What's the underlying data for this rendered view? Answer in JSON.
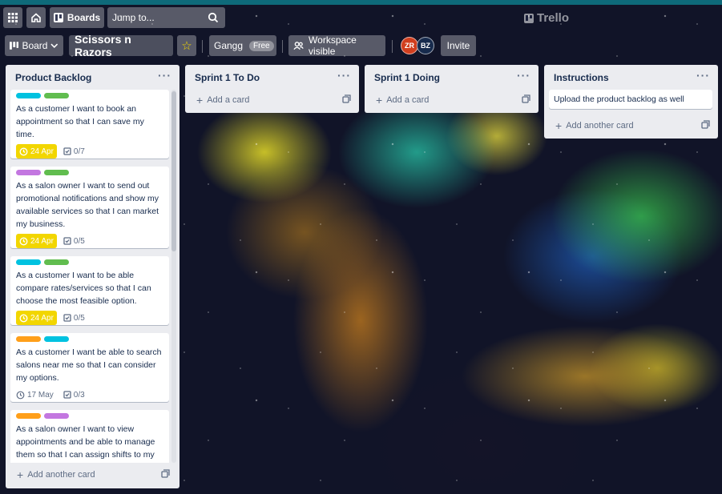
{
  "topbar": {
    "boards_label": "Boards",
    "search_label": "Jump to...",
    "logo_text": "Trello"
  },
  "board_header": {
    "view_label": "Board",
    "title": "Scissors n Razors",
    "workspace_name": "Gangg",
    "workspace_plan": "Free",
    "visibility_label": "Workspace visible",
    "members": [
      "ZR",
      "BZ"
    ],
    "invite_label": "Invite"
  },
  "colors": {
    "label_cyan": "#00c2e0",
    "label_green": "#61bd4f",
    "label_purple": "#c377e0",
    "label_orange": "#ff9f1a",
    "due_soon": "#f2d600"
  },
  "lists": [
    {
      "title": "Product Backlog",
      "add_label": "Add another card",
      "cards": [
        {
          "labels": [
            "cyan",
            "green"
          ],
          "text": "As a customer I want to book an appointment so that I can save my time.",
          "due": "24 Apr",
          "due_style": "soon",
          "checklist": "0/7"
        },
        {
          "labels": [
            "purple",
            "green"
          ],
          "text": "As a salon owner I want to send out promotional notifications and show my available services so that I can market my business.",
          "due": "24 Apr",
          "due_style": "soon",
          "checklist": "0/5"
        },
        {
          "labels": [
            "cyan",
            "green"
          ],
          "text": "As a customer I want to be able compare rates/services so that I can choose the most feasible option.",
          "due": "24 Apr",
          "due_style": "soon",
          "checklist": "0/5"
        },
        {
          "labels": [
            "orange",
            "cyan"
          ],
          "text": "As a customer I want be able to search salons near me so that I can consider my options.",
          "due": "17 May",
          "due_style": "plain",
          "checklist": "0/3"
        },
        {
          "labels": [
            "orange",
            "purple"
          ],
          "text": "As a salon owner I want to view appointments and be able to manage them so that I can assign shifts to my employees efficiently.",
          "due": "",
          "due_style": "plain",
          "checklist": ""
        }
      ]
    },
    {
      "title": "Sprint 1 To Do",
      "add_label": "Add a card",
      "cards": []
    },
    {
      "title": "Sprint 1 Doing",
      "add_label": "Add a card",
      "cards": []
    },
    {
      "title": "Instructions",
      "add_label": "Add another card",
      "cards": [
        {
          "text": "Upload the product backlog as well"
        }
      ]
    }
  ]
}
